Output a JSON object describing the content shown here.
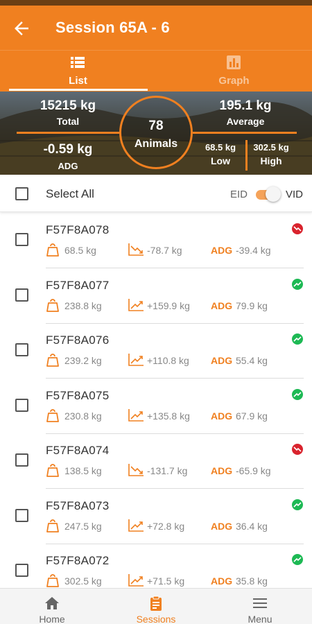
{
  "header": {
    "title": "Session 65A - 6"
  },
  "tabs": [
    {
      "label": "List",
      "icon": "list-icon",
      "active": true
    },
    {
      "label": "Graph",
      "icon": "bar-chart-icon",
      "active": false
    }
  ],
  "summary": {
    "total_value": "15215 kg",
    "total_label": "Total",
    "average_value": "195.1 kg",
    "average_label": "Average",
    "adg_value": "-0.59 kg",
    "adg_label": "ADG",
    "animals_count": "78",
    "animals_label": "Animals",
    "low_value": "68.5 kg",
    "low_label": "Low",
    "high_value": "302.5 kg",
    "high_label": "High"
  },
  "select_bar": {
    "select_all": "Select All",
    "eid": "EID",
    "vid": "VID",
    "toggle_on": "VID"
  },
  "colors": {
    "accent": "#f08020",
    "up": "#1db954",
    "down": "#d9232d"
  },
  "animals": [
    {
      "id": "F57F8A078",
      "weight": "68.5 kg",
      "gain": "-78.7 kg",
      "adg_label": "ADG",
      "adg": "-39.4 kg",
      "trend": "down"
    },
    {
      "id": "F57F8A077",
      "weight": "238.8 kg",
      "gain": "+159.9 kg",
      "adg_label": "ADG",
      "adg": "79.9 kg",
      "trend": "up"
    },
    {
      "id": "F57F8A076",
      "weight": "239.2 kg",
      "gain": "+110.8 kg",
      "adg_label": "ADG",
      "adg": "55.4 kg",
      "trend": "up"
    },
    {
      "id": "F57F8A075",
      "weight": "230.8 kg",
      "gain": "+135.8 kg",
      "adg_label": "ADG",
      "adg": "67.9 kg",
      "trend": "up"
    },
    {
      "id": "F57F8A074",
      "weight": "138.5 kg",
      "gain": "-131.7 kg",
      "adg_label": "ADG",
      "adg": "-65.9 kg",
      "trend": "down"
    },
    {
      "id": "F57F8A073",
      "weight": "247.5 kg",
      "gain": "+72.8 kg",
      "adg_label": "ADG",
      "adg": "36.4 kg",
      "trend": "up"
    },
    {
      "id": "F57F8A072",
      "weight": "302.5 kg",
      "gain": "+71.5 kg",
      "adg_label": "ADG",
      "adg": "35.8 kg",
      "trend": "up"
    }
  ],
  "bottom_nav": [
    {
      "label": "Home",
      "icon": "home-icon",
      "active": false
    },
    {
      "label": "Sessions",
      "icon": "clipboard-icon",
      "active": true
    },
    {
      "label": "Menu",
      "icon": "hamburger-menu-icon",
      "active": false
    }
  ]
}
